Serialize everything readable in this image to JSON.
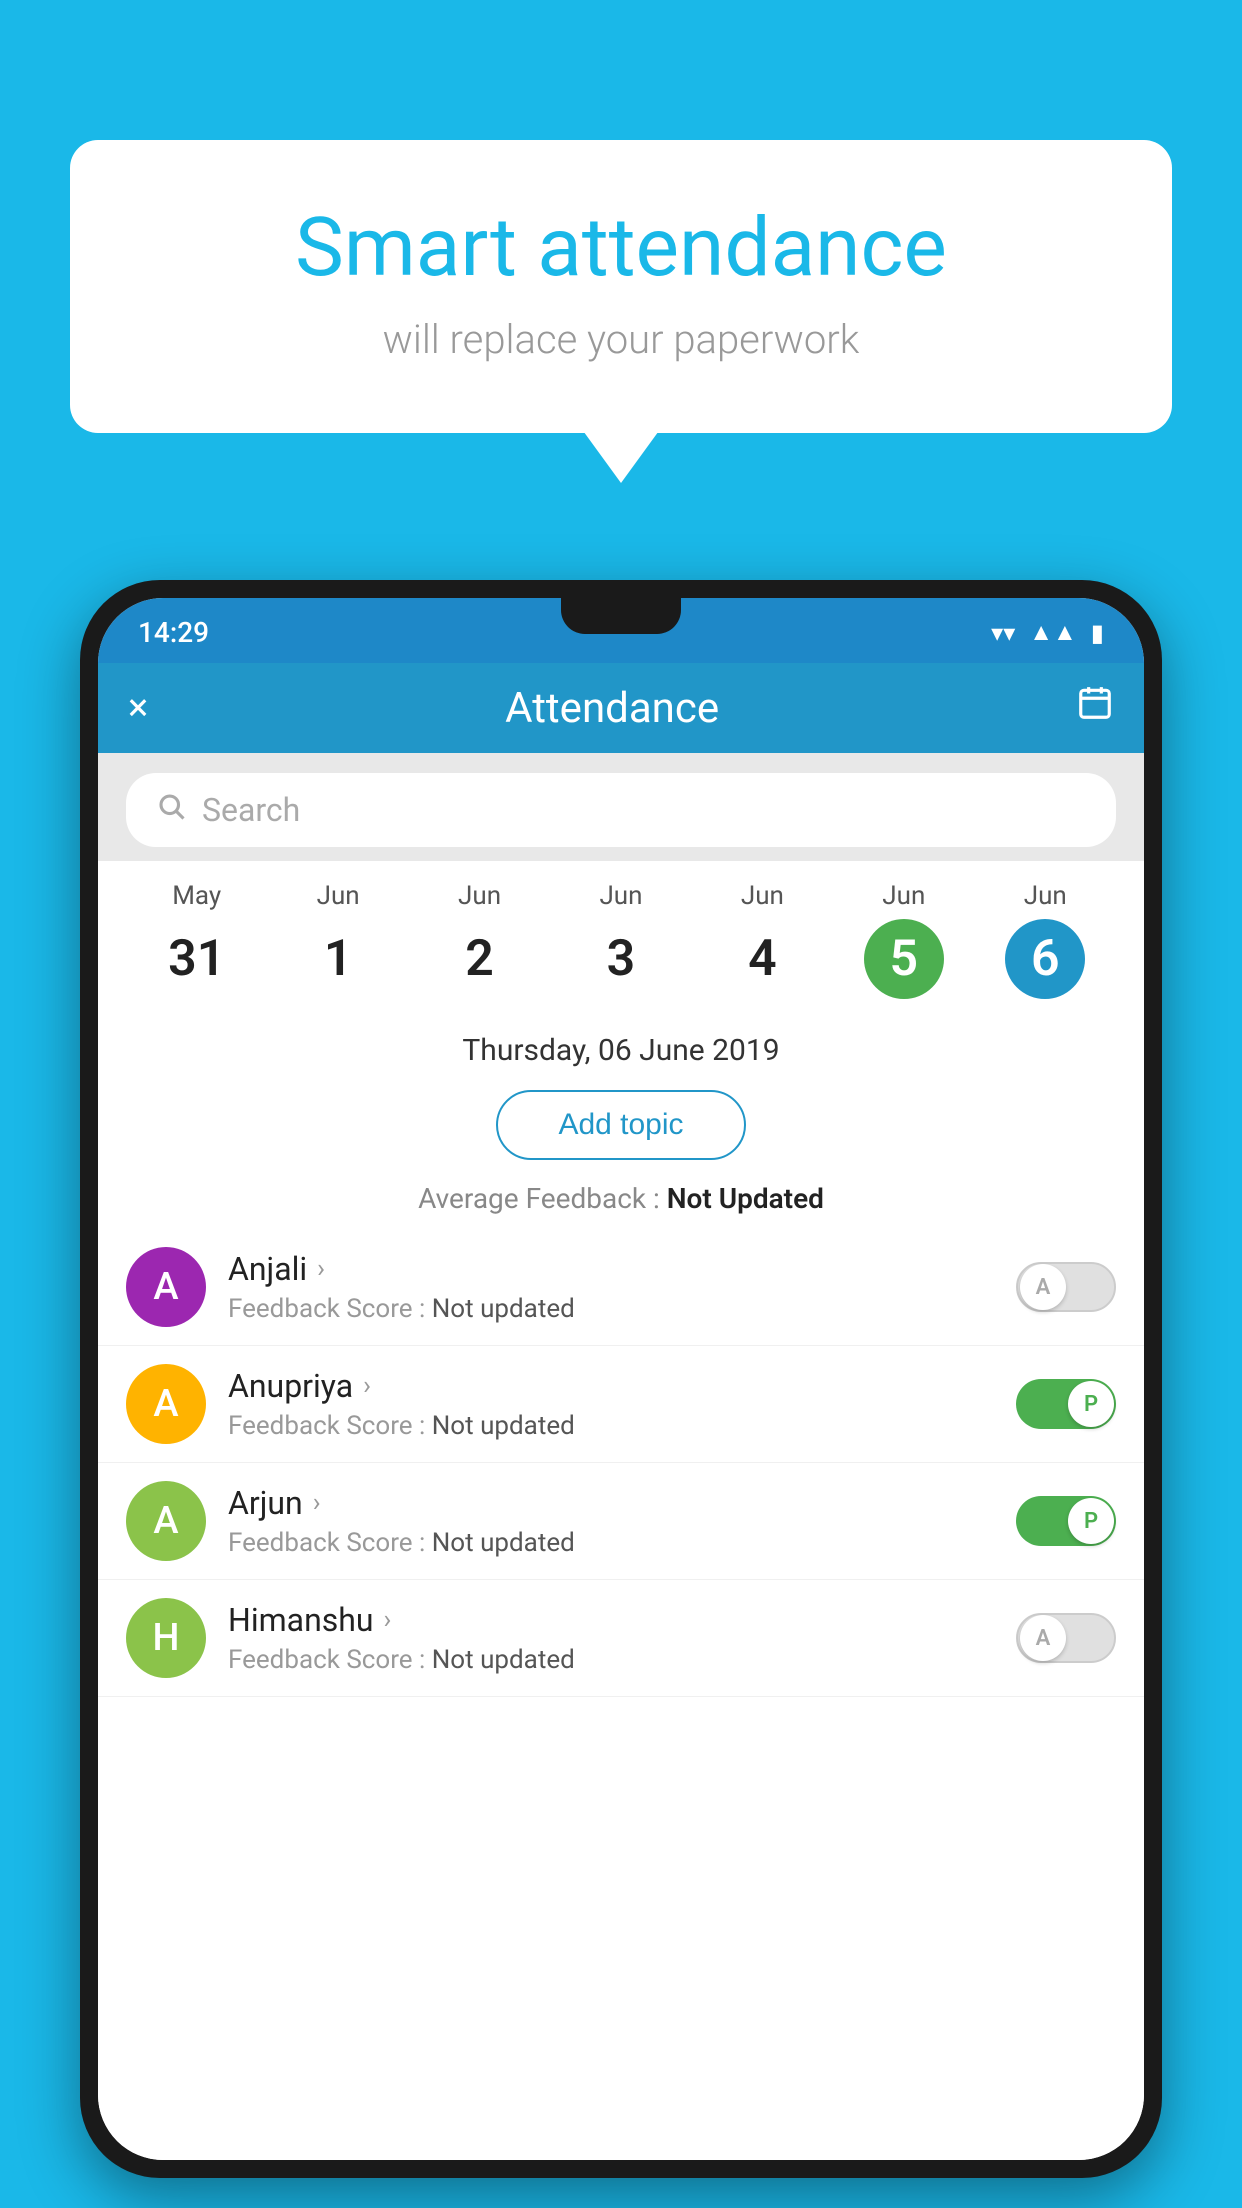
{
  "background_color": "#1ab8e8",
  "speech_bubble": {
    "title": "Smart attendance",
    "subtitle": "will replace your paperwork"
  },
  "status_bar": {
    "time": "14:29",
    "wifi": "▼",
    "signal": "◀",
    "battery": "▮"
  },
  "app_bar": {
    "title": "Attendance",
    "close_label": "×",
    "calendar_label": "📅"
  },
  "search": {
    "placeholder": "Search"
  },
  "date_picker": {
    "dates": [
      {
        "month": "May",
        "day": "31",
        "selected": false
      },
      {
        "month": "Jun",
        "day": "1",
        "selected": false
      },
      {
        "month": "Jun",
        "day": "2",
        "selected": false
      },
      {
        "month": "Jun",
        "day": "3",
        "selected": false
      },
      {
        "month": "Jun",
        "day": "4",
        "selected": false
      },
      {
        "month": "Jun",
        "day": "5",
        "selected": "green"
      },
      {
        "month": "Jun",
        "day": "6",
        "selected": "blue"
      }
    ]
  },
  "selected_date": "Thursday, 06 June 2019",
  "add_topic_label": "Add topic",
  "average_feedback": {
    "label": "Average Feedback : ",
    "value": "Not Updated"
  },
  "students": [
    {
      "name": "Anjali",
      "avatar_letter": "A",
      "avatar_color": "#9c27b0",
      "feedback_label": "Feedback Score : ",
      "feedback_value": "Not updated",
      "attendance": "A",
      "toggle_on": false
    },
    {
      "name": "Anupriya",
      "avatar_letter": "A",
      "avatar_color": "#ffb300",
      "feedback_label": "Feedback Score : ",
      "feedback_value": "Not updated",
      "attendance": "P",
      "toggle_on": true
    },
    {
      "name": "Arjun",
      "avatar_letter": "A",
      "avatar_color": "#8bc34a",
      "feedback_label": "Feedback Score : ",
      "feedback_value": "Not updated",
      "attendance": "P",
      "toggle_on": true
    },
    {
      "name": "Himanshu",
      "avatar_letter": "H",
      "avatar_color": "#8bc34a",
      "feedback_label": "Feedback Score : ",
      "feedback_value": "Not updated",
      "attendance": "A",
      "toggle_on": false
    }
  ]
}
